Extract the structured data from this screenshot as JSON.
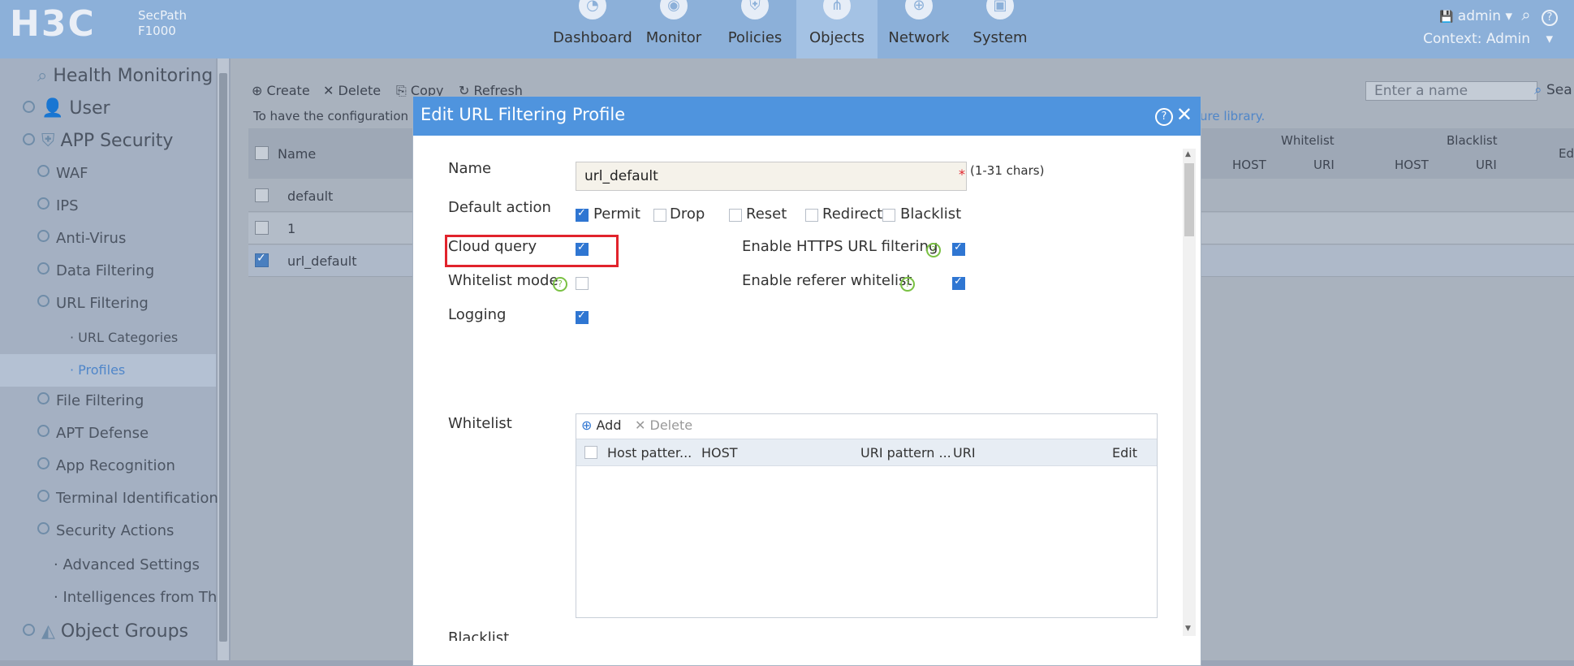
{
  "brand": {
    "logo_text": "H3C",
    "product_line1": "SecPath",
    "product_line2": "F1000"
  },
  "nav": {
    "items": [
      {
        "label": "Dashboard",
        "icon": "gauge-icon",
        "glyph": "◔"
      },
      {
        "label": "Monitor",
        "icon": "monitor-icon",
        "glyph": "◉"
      },
      {
        "label": "Policies",
        "icon": "shield-icon",
        "glyph": "⛨"
      },
      {
        "label": "Objects",
        "icon": "share-icon",
        "glyph": "⋔"
      },
      {
        "label": "Network",
        "icon": "globe-icon",
        "glyph": "⊕"
      },
      {
        "label": "System",
        "icon": "system-icon",
        "glyph": "▣"
      }
    ],
    "active": "Objects"
  },
  "user": {
    "save_glyph": "💾",
    "name": "admin ▾",
    "search_glyph": "⌕",
    "help_glyph": "?",
    "context": "Context: Admin",
    "context_arrow": "▾"
  },
  "sidebar": {
    "items": [
      {
        "label": "Health Monitoring"
      },
      {
        "label": "User"
      },
      {
        "label": "APP Security"
      },
      {
        "label": "WAF"
      },
      {
        "label": "IPS"
      },
      {
        "label": "Anti-Virus"
      },
      {
        "label": "Data Filtering"
      },
      {
        "label": "URL Filtering"
      },
      {
        "label": "· URL Categories"
      },
      {
        "label": "· Profiles"
      },
      {
        "label": "File Filtering"
      },
      {
        "label": "APT Defense"
      },
      {
        "label": "App Recognition"
      },
      {
        "label": "Terminal Identification"
      },
      {
        "label": "Security Actions"
      },
      {
        "label": "· Advanced Settings"
      },
      {
        "label": "· Intelligences from Thre"
      },
      {
        "label": "Object Groups"
      }
    ]
  },
  "main": {
    "toolbar": {
      "create": "Create",
      "delete": "Delete",
      "copy": "Copy",
      "refresh": "Refresh"
    },
    "notice_left": "To have the configuration",
    "notice_right": "ure library.",
    "search_placeholder": "Enter a name",
    "search_label": "Sea",
    "table": {
      "name_header": "Name",
      "whitelist_header": "Whitelist",
      "blacklist_header": "Blacklist",
      "host_header": "HOST",
      "uri_header": "URI",
      "edit_header": "Ed",
      "rows": [
        {
          "name": "default",
          "checked": false
        },
        {
          "name": "1",
          "checked": false
        },
        {
          "name": "url_default",
          "checked": true
        }
      ]
    }
  },
  "dialog": {
    "title": "Edit URL Filtering Profile",
    "help_glyph": "?",
    "close_glyph": "✕",
    "name_label": "Name",
    "name_value": "url_default",
    "name_required": "*",
    "name_hint": "(1-31 chars)",
    "default_action_label": "Default action",
    "actions": [
      {
        "label": "Permit",
        "checked": true
      },
      {
        "label": "Drop",
        "checked": false
      },
      {
        "label": "Reset",
        "checked": false
      },
      {
        "label": "Redirect",
        "checked": false
      },
      {
        "label": "Blacklist",
        "checked": false
      }
    ],
    "cloud_query_label": "Cloud query",
    "https_label": "Enable HTTPS URL filtering",
    "whitelist_mode_label": "Whitelist mode",
    "referer_label": "Enable referer whitelist",
    "logging_label": "Logging",
    "whitelist_label": "Whitelist",
    "whitelist_add": "Add",
    "whitelist_delete": "Delete",
    "wl_columns": {
      "host_pattern": "Host patter...",
      "host": "HOST",
      "uri_pattern": "URI pattern ...",
      "uri": "URI",
      "edit": "Edit"
    },
    "blacklist_label": "Blacklist"
  }
}
